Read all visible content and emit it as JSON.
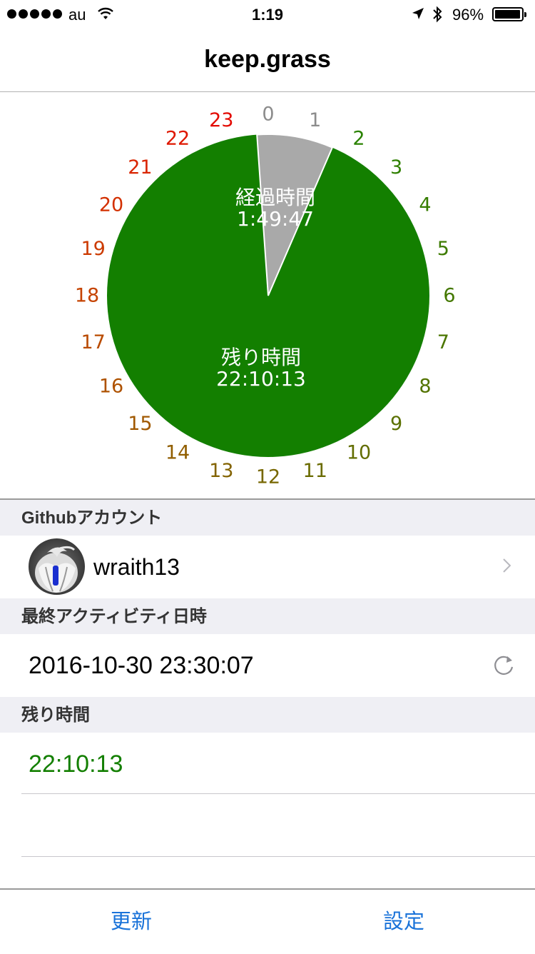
{
  "status_bar": {
    "carrier": "au",
    "time": "1:19",
    "battery_percent_label": "96%",
    "battery_level": 0.96
  },
  "nav": {
    "title": "keep.grass"
  },
  "clock": {
    "elapsed_label": "経過時間",
    "elapsed_time": "1:49:47",
    "remaining_label": "残り時間",
    "remaining_time": "22:10:13",
    "elapsed_fraction": 0.0762,
    "colors": {
      "remaining": "#137f00",
      "elapsed": "#a9a9a9",
      "stroke": "#ffffff"
    },
    "hours": [
      {
        "label": "0",
        "color": "#8c8c8c"
      },
      {
        "label": "1",
        "color": "#8c8c8c"
      },
      {
        "label": "2",
        "color": "#2a8200"
      },
      {
        "label": "3",
        "color": "#2f8000"
      },
      {
        "label": "4",
        "color": "#367d00"
      },
      {
        "label": "5",
        "color": "#3d7b00"
      },
      {
        "label": "6",
        "color": "#447800"
      },
      {
        "label": "7",
        "color": "#4b7600"
      },
      {
        "label": "8",
        "color": "#537300"
      },
      {
        "label": "9",
        "color": "#5a7000"
      },
      {
        "label": "10",
        "color": "#626d00"
      },
      {
        "label": "11",
        "color": "#6a6b00"
      },
      {
        "label": "12",
        "color": "#776700"
      },
      {
        "label": "13",
        "color": "#836300"
      },
      {
        "label": "14",
        "color": "#915e00"
      },
      {
        "label": "15",
        "color": "#a05800"
      },
      {
        "label": "16",
        "color": "#ae5200"
      },
      {
        "label": "17",
        "color": "#b94b00"
      },
      {
        "label": "18",
        "color": "#c54300"
      },
      {
        "label": "19",
        "color": "#cc3a00"
      },
      {
        "label": "20",
        "color": "#d33000"
      },
      {
        "label": "21",
        "color": "#d92500"
      },
      {
        "label": "22",
        "color": "#df1800"
      },
      {
        "label": "23",
        "color": "#e30a00"
      }
    ]
  },
  "account_section": {
    "header": "Githubアカウント",
    "username": "wraith13",
    "chevron": "chevron-right-icon"
  },
  "activity_section": {
    "header": "最終アクティビティ日時",
    "datetime": "2016-10-30 23:30:07",
    "refresh": "refresh-icon"
  },
  "remaining_section": {
    "header": "残り時間",
    "value": "22:10:13",
    "color": "#137f00"
  },
  "toolbar": {
    "update_label": "更新",
    "settings_label": "設定",
    "tint": "#1a73d9"
  }
}
